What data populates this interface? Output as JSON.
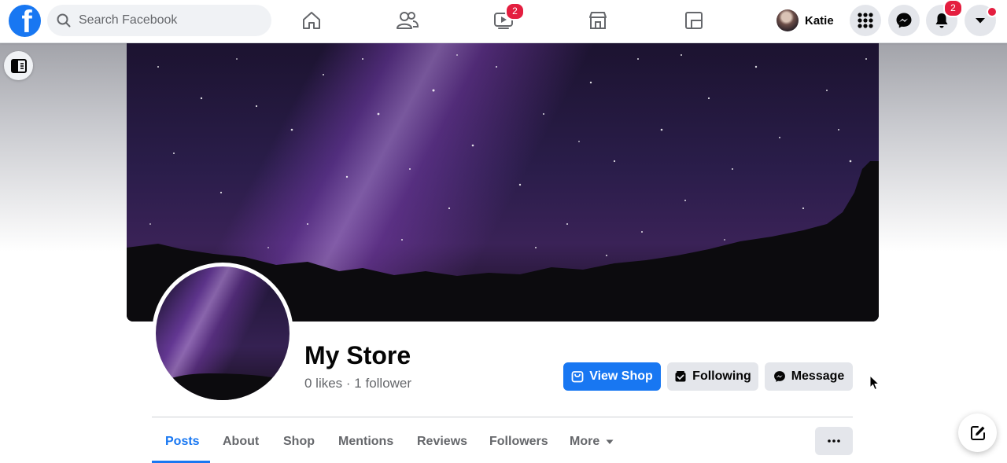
{
  "topbar": {
    "search_placeholder": "Search Facebook",
    "watch_badge": "2",
    "profile_name": "Katie",
    "notifications_badge": "2"
  },
  "page": {
    "name": "My Store",
    "stats": "0 likes · 1 follower"
  },
  "actions": {
    "view_shop": "View Shop",
    "following": "Following",
    "message": "Message"
  },
  "tabs": [
    {
      "label": "Posts"
    },
    {
      "label": "About"
    },
    {
      "label": "Shop"
    },
    {
      "label": "Mentions"
    },
    {
      "label": "Reviews"
    },
    {
      "label": "Followers"
    },
    {
      "label": "More"
    }
  ],
  "colors": {
    "brand": "#1877f2",
    "badge": "#e41e3f",
    "button_secondary": "#e4e6eb"
  },
  "icons": {
    "logo": "facebook-logo",
    "nav": [
      "home-icon",
      "friends-icon",
      "watch-icon",
      "marketplace-icon",
      "groups-icon"
    ],
    "right": [
      "menu-grid-icon",
      "messenger-icon",
      "bell-icon",
      "caret-down-icon"
    ]
  }
}
